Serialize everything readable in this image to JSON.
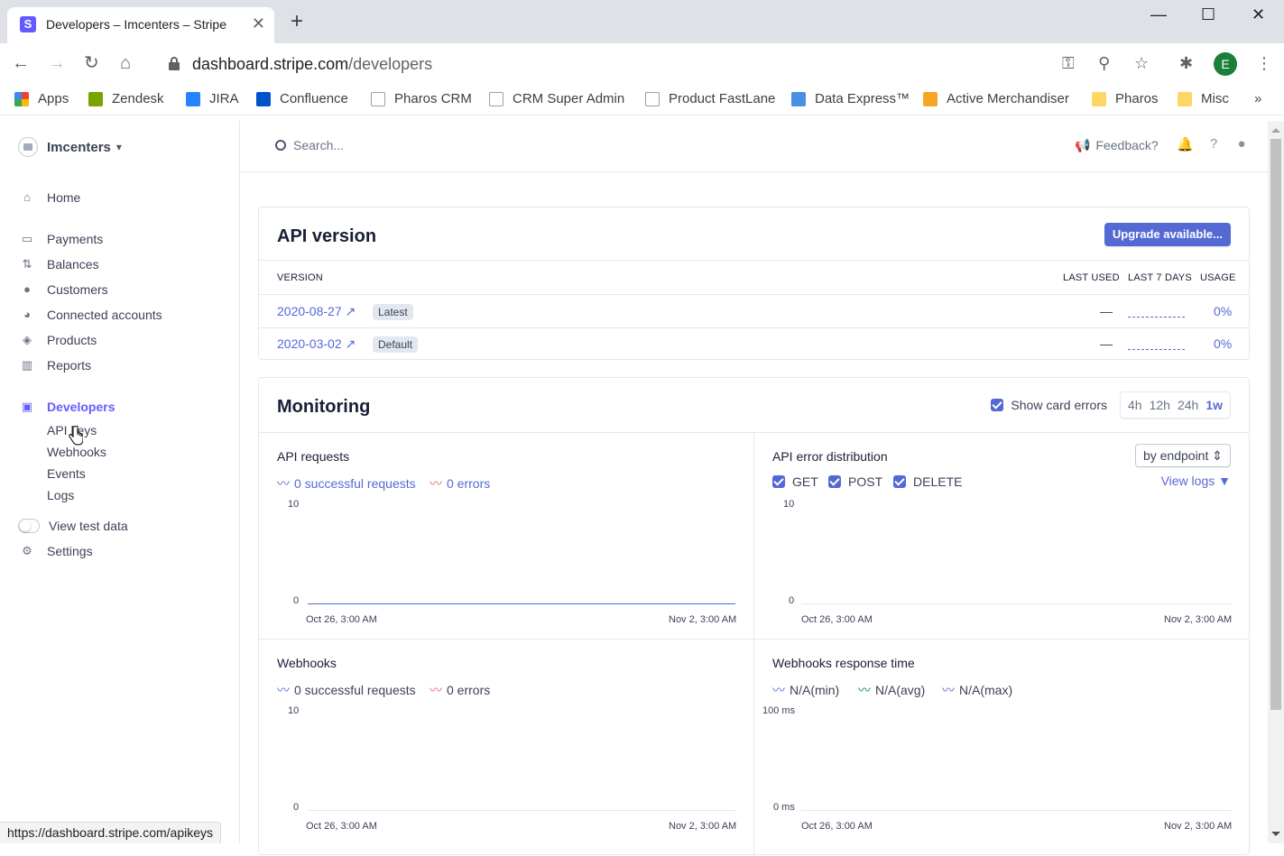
{
  "browser": {
    "tab_title": "Developers – Imcenters – Stripe",
    "favicon": "S",
    "url_host": "dashboard.stripe.com",
    "url_path": "/developers",
    "profile_initial": "E",
    "status_url": "https://dashboard.stripe.com/apikeys"
  },
  "bookmarks": [
    {
      "label": "Apps",
      "icon": "apps-grid-icon"
    },
    {
      "label": "Zendesk",
      "icon": "zendesk-icon"
    },
    {
      "label": "JIRA",
      "icon": "jira-icon"
    },
    {
      "label": "Confluence",
      "icon": "confluence-icon"
    },
    {
      "label": "Pharos CRM",
      "icon": "page-icon"
    },
    {
      "label": "CRM Super Admin",
      "icon": "page-icon"
    },
    {
      "label": "Product FastLane",
      "icon": "page-icon"
    },
    {
      "label": "Data Express™",
      "icon": "hexagon-icon"
    },
    {
      "label": "Active Merchandiser",
      "icon": "am-icon"
    },
    {
      "label": "Pharos",
      "icon": "folder-icon"
    },
    {
      "label": "Misc",
      "icon": "folder-icon"
    }
  ],
  "sidebar": {
    "account": "Imcenters",
    "home": "Home",
    "items": [
      "Payments",
      "Balances",
      "Customers",
      "Connected accounts",
      "Products",
      "Reports"
    ],
    "developers": "Developers",
    "dev_items": [
      "API keys",
      "Webhooks",
      "Events",
      "Logs"
    ],
    "test_data": "View test data",
    "settings": "Settings"
  },
  "header": {
    "search_placeholder": "Search...",
    "feedback": "Feedback?"
  },
  "api_version": {
    "title": "API version",
    "upgrade_button": "Upgrade available...",
    "columns": [
      "VERSION",
      "LAST USED",
      "LAST 7 DAYS",
      "USAGE"
    ],
    "rows": [
      {
        "version": "2020-08-27",
        "badge": "Latest",
        "last_used": "—",
        "usage": "0%"
      },
      {
        "version": "2020-03-02",
        "badge": "Default",
        "last_used": "—",
        "usage": "0%"
      }
    ]
  },
  "monitoring": {
    "title": "Monitoring",
    "show_card_errors": "Show card errors",
    "ranges": [
      "4h",
      "12h",
      "24h",
      "1w"
    ],
    "selected_range": "1w",
    "api_requests": {
      "title": "API requests",
      "success": "0 successful requests",
      "errors": "0 errors",
      "y_max": "10",
      "y_min": "0",
      "x_start": "Oct 26, 3:00 AM",
      "x_end": "Nov 2, 3:00 AM"
    },
    "api_error_distribution": {
      "title": "API error distribution",
      "select": "by endpoint",
      "methods": [
        "GET",
        "POST",
        "DELETE"
      ],
      "view_logs": "View logs",
      "y_max": "10",
      "y_min": "0",
      "x_start": "Oct 26, 3:00 AM",
      "x_end": "Nov 2, 3:00 AM"
    },
    "webhooks": {
      "title": "Webhooks",
      "success": "0 successful requests",
      "errors": "0 errors",
      "y_max": "10",
      "y_min": "0",
      "x_start": "Oct 26, 3:00 AM",
      "x_end": "Nov 2, 3:00 AM"
    },
    "webhooks_response": {
      "title": "Webhooks response time",
      "legend": [
        "N/A(min)",
        "N/A(avg)",
        "N/A(max)"
      ],
      "y_max": "100 ms",
      "y_min": "0 ms",
      "x_start": "Oct 26, 3:00 AM",
      "x_end": "Nov 2, 3:00 AM"
    }
  },
  "colors": {
    "accent": "#5469d4",
    "brand": "#635bff",
    "error": "#ed5f74",
    "green": "#09825d"
  }
}
